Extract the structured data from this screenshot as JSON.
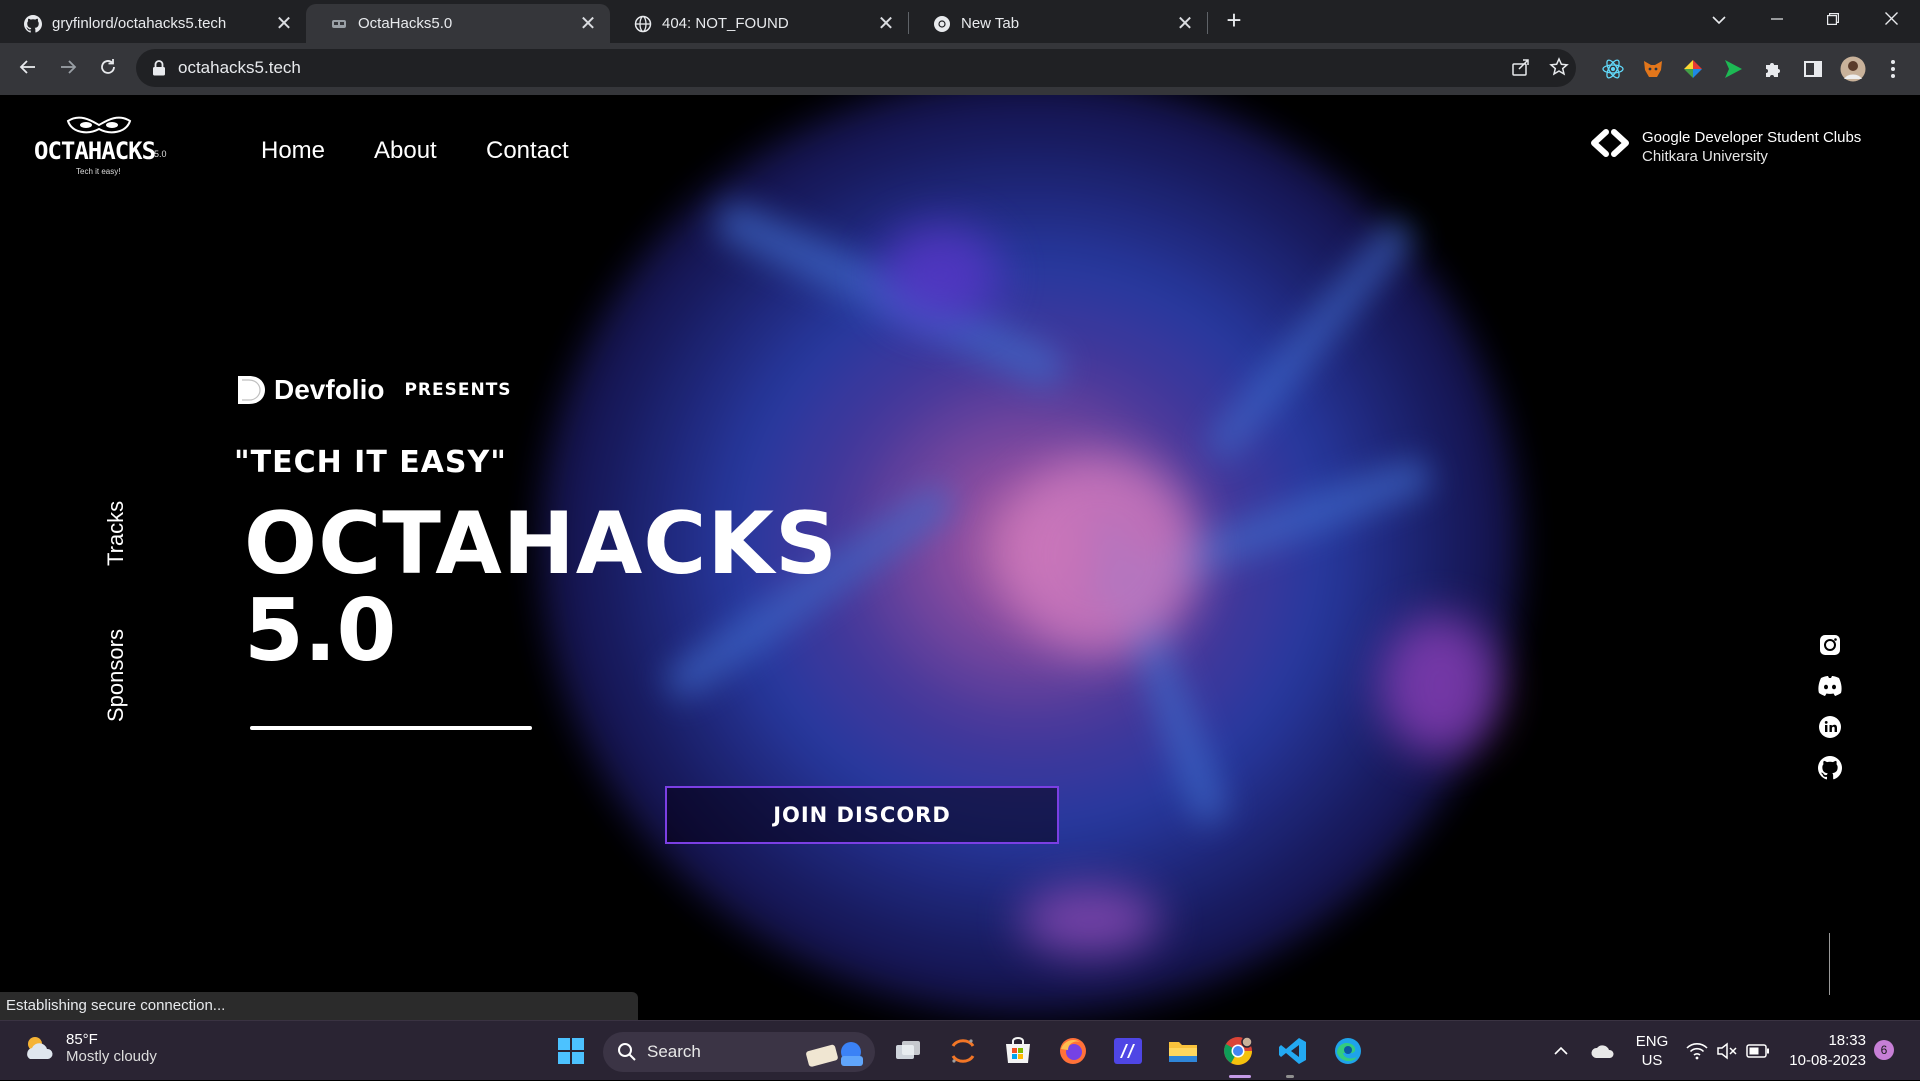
{
  "browser": {
    "tabs": [
      {
        "title": "gryfinlord/octahacks5.tech",
        "favicon": "github-icon",
        "active": false
      },
      {
        "title": "OctaHacks5.0",
        "favicon": "octahacks-icon",
        "active": true
      },
      {
        "title": "404: NOT_FOUND",
        "favicon": "globe-icon",
        "active": false
      },
      {
        "title": "New Tab",
        "favicon": "chrome-icon",
        "active": false
      }
    ],
    "close_glyph": "✕",
    "new_tab_glyph": "+",
    "url": "octahacks5.tech",
    "status_text": "Establishing secure connection..."
  },
  "site": {
    "logo_text": "OCTAHACKS",
    "logo_version": "5.0",
    "logo_tagline": "Tech it easy!",
    "nav": [
      "Home",
      "About",
      "Contact"
    ],
    "gdsc_line1": "Google Developer Student Clubs",
    "gdsc_line2": "Chitkara University",
    "side_links": [
      "Tracks",
      "Sponsors"
    ],
    "sponsor_name": "Devfolio",
    "presents": "PRESENTS",
    "tagline": "\"TECH IT EASY\"",
    "title_line1": "OCTAHACKS",
    "title_line2": "5.0",
    "cta": "JOIN DISCORD",
    "socials": [
      "instagram-icon",
      "discord-icon",
      "linkedin-icon",
      "github-icon"
    ],
    "colors": {
      "accent": "#7b3fe4",
      "background": "#000000"
    }
  },
  "taskbar": {
    "temperature": "85°F",
    "weather": "Mostly cloudy",
    "search_label": "Search",
    "language_line1": "ENG",
    "language_line2": "US",
    "time": "18:33",
    "date": "10-08-2023",
    "notifications": "6"
  }
}
